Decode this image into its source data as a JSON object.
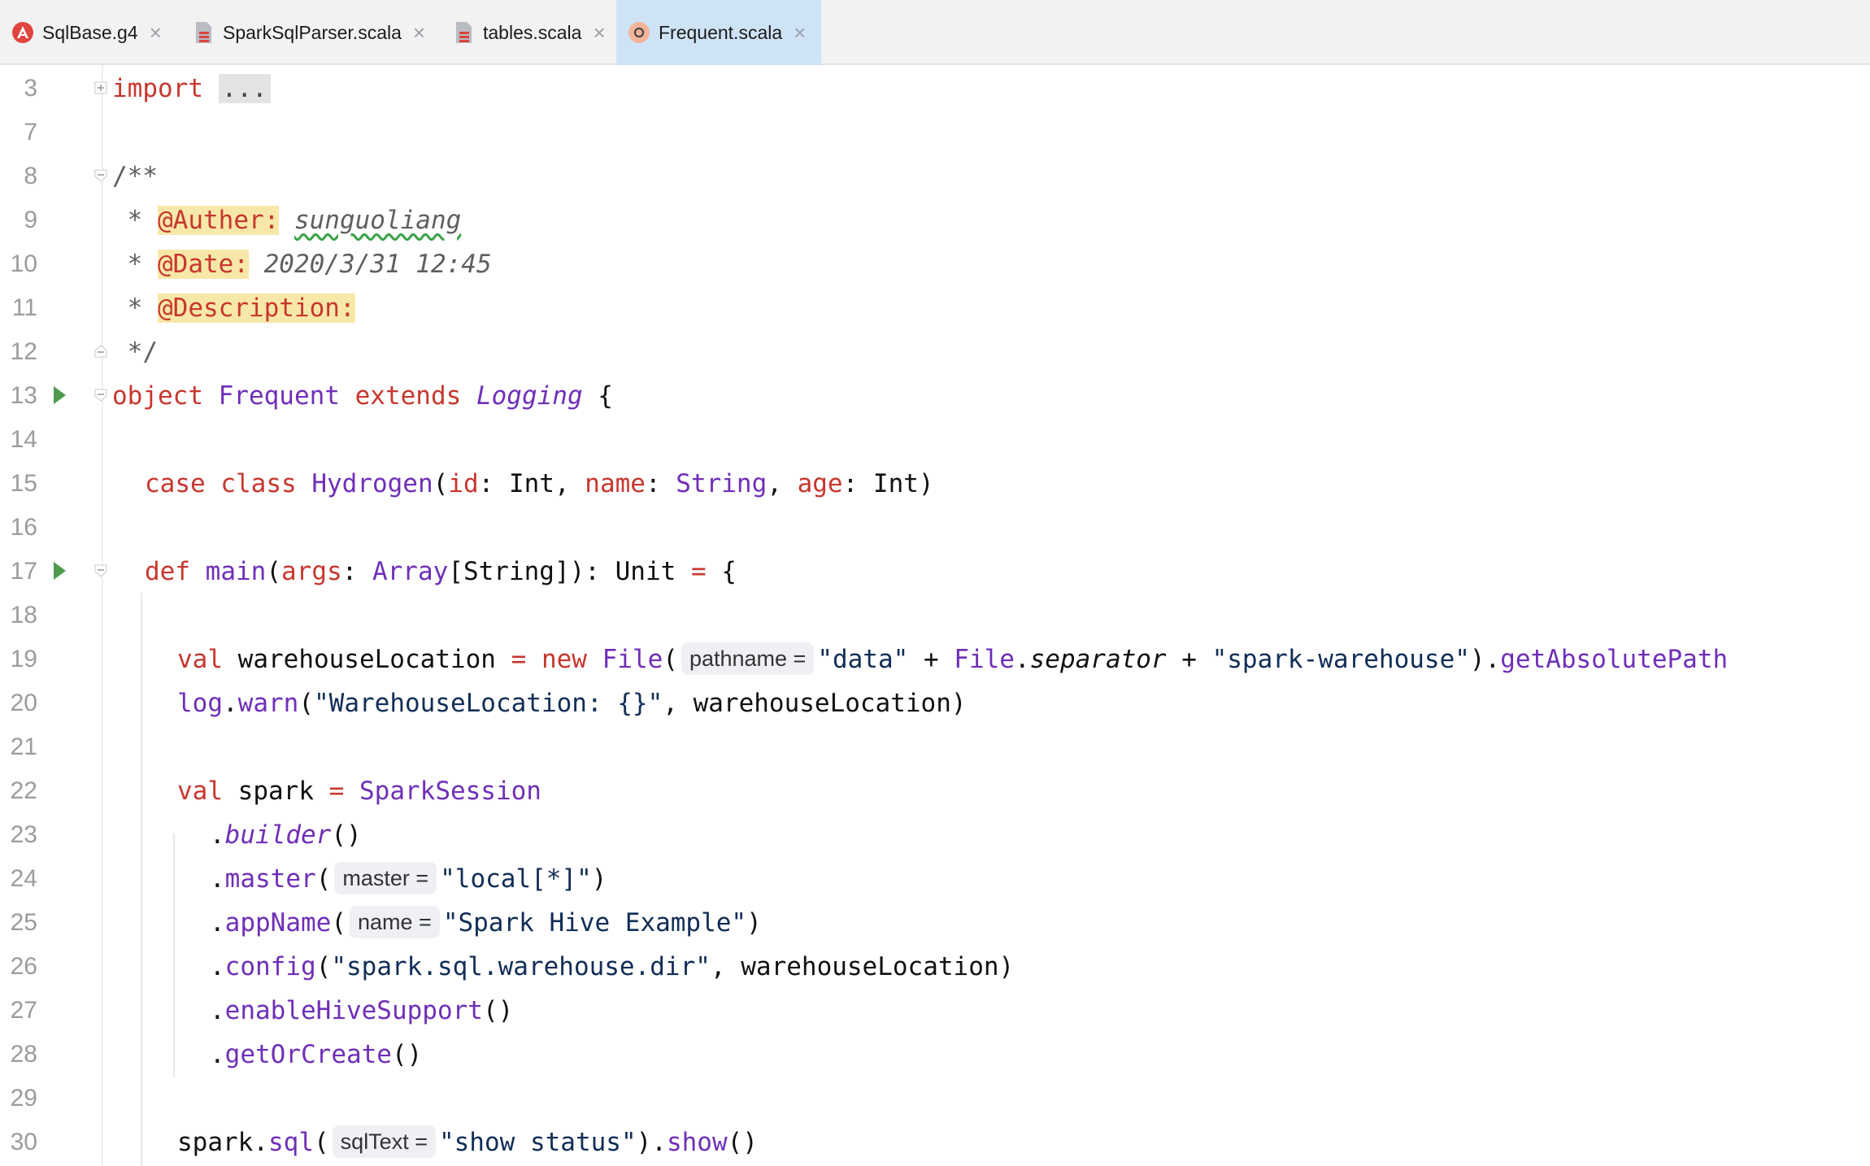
{
  "tabs": [
    {
      "label": "SqlBase.g4",
      "icon": "antlr-icon",
      "active": false
    },
    {
      "label": "SparkSqlParser.scala",
      "icon": "scala-file-icon",
      "active": false
    },
    {
      "label": "tables.scala",
      "icon": "scala-file-icon",
      "active": false
    },
    {
      "label": "Frequent.scala",
      "icon": "scala-object-icon",
      "active": true
    }
  ],
  "close_glyph": "×",
  "line_numbers": [
    "3",
    "7",
    "8",
    "9",
    "10",
    "11",
    "12",
    "13",
    "14",
    "15",
    "16",
    "17",
    "18",
    "19",
    "20",
    "21",
    "22",
    "23",
    "24",
    "25",
    "26",
    "27",
    "28",
    "29",
    "30"
  ],
  "code": {
    "l3": {
      "kw": "import",
      "folded": "..."
    },
    "l8": "/**",
    "l9": {
      "star": " * ",
      "tag": "@Auther:",
      "value": "sunguoliang"
    },
    "l10": {
      "star": " * ",
      "tag": "@Date:",
      "value": " 2020/3/31 12:45"
    },
    "l11": {
      "star": " * ",
      "tag": "@Description:"
    },
    "l12": " */",
    "l13": {
      "kw1": "object",
      "name": "Frequent",
      "kw2": "extends",
      "trait": "Logging",
      "brace": " {"
    },
    "l15": {
      "kw1": "case",
      "kw2": "class",
      "name": "Hydrogen",
      "p1": "id",
      "t1": ": Int, ",
      "p2": "name",
      "t2a": ": ",
      "t2": "String",
      "t2b": ", ",
      "p3": "age",
      "t3": ": Int)"
    },
    "l17": {
      "kw": "def",
      "name": "main",
      "open": "(",
      "p": "args",
      "colon": ": ",
      "type": "Array",
      "rest1": "[String]): Unit ",
      "eq": "=",
      "rest2": " {"
    },
    "l19": {
      "kw": "val",
      "var": " warehouseLocation ",
      "eq": "=",
      "nw": "new",
      "cls": "File",
      "open": "(",
      "hint": "pathname =",
      "s1": "\"data\"",
      "plus1": " + ",
      "cls2": "File",
      "dot": ".",
      "sep": "separator",
      "plus2": " + ",
      "s2": "\"spark-warehouse\"",
      "close": ").",
      "m": "getAbsolutePath"
    },
    "l20": {
      "obj": "log",
      "dot": ".",
      "m": "warn",
      "open": "(",
      "s": "\"WarehouseLocation: {}\"",
      "rest": ", warehouseLocation)"
    },
    "l22": {
      "kw": "val",
      "var": " spark ",
      "eq": "=",
      "cls": "SparkSession"
    },
    "l23": {
      "dot": ".",
      "m": "builder",
      "rest": "()"
    },
    "l24": {
      "dot": ".",
      "m": "master",
      "open": "(",
      "hint": "master =",
      "s": "\"local[*]\"",
      "rest": ")"
    },
    "l25": {
      "dot": ".",
      "m": "appName",
      "open": "(",
      "hint": "name =",
      "s": "\"Spark Hive Example\"",
      "rest": ")"
    },
    "l26": {
      "dot": ".",
      "m": "config",
      "open": "(",
      "s": "\"spark.sql.warehouse.dir\"",
      "rest": ", warehouseLocation)"
    },
    "l27": {
      "dot": ".",
      "m": "enableHiveSupport",
      "rest": "()"
    },
    "l28": {
      "dot": ".",
      "m": "getOrCreate",
      "rest": "()"
    },
    "l30": {
      "obj": "spark",
      "dot": ".",
      "m": "sql",
      "open": "(",
      "hint": "sqlText =",
      "s": "\"show status\"",
      "close": ").",
      "m2": "show",
      "rest": "()"
    }
  }
}
